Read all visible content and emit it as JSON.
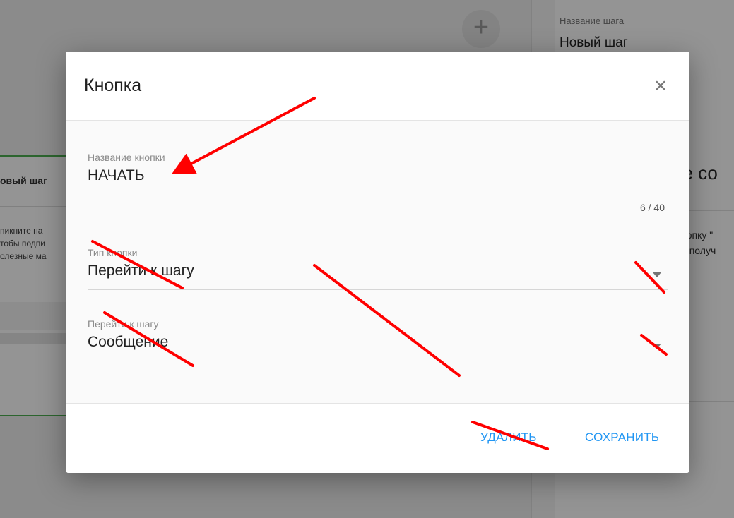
{
  "background": {
    "add_symbol": "+",
    "left_card": {
      "title": "овый шаг",
      "text_lines": [
        "пикните на",
        "тобы подпи",
        "олезные ма"
      ]
    },
    "right_panel": {
      "step_name_label": "Название шага",
      "step_name_value": "Новый шаг",
      "peek_title": "ре со",
      "peek_text_lines": [
        "нопку \"",
        "и получ"
      ]
    }
  },
  "dialog": {
    "title": "Кнопка",
    "close_icon": "×",
    "button_name": {
      "label": "Название кнопки",
      "value": "НАЧАТЬ",
      "counter": "6 / 40"
    },
    "button_type": {
      "label": "Тип кнопки",
      "value": "Перейти к шагу"
    },
    "goto_step": {
      "label": "Перейти к шагу",
      "value": "Сообщение"
    },
    "footer": {
      "delete_label": "УДАЛИТЬ",
      "save_label": "СОХРАНИТЬ"
    }
  },
  "colors": {
    "accent": "#2196f3",
    "annotation": "#ff0000",
    "step_border": "#4caf50"
  }
}
